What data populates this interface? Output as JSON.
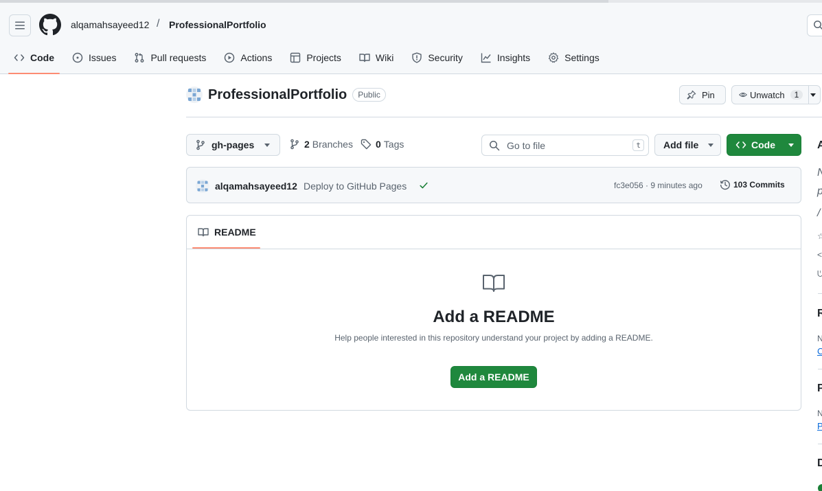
{
  "header": {
    "owner": "alqamahsayeed12",
    "separator": "/",
    "repo": "ProfessionalPortfolio"
  },
  "tabs": [
    {
      "label": "Code",
      "icon": "code-icon",
      "active": true
    },
    {
      "label": "Issues",
      "icon": "issue-icon"
    },
    {
      "label": "Pull requests",
      "icon": "pull-request-icon"
    },
    {
      "label": "Actions",
      "icon": "play-icon"
    },
    {
      "label": "Projects",
      "icon": "table-icon"
    },
    {
      "label": "Wiki",
      "icon": "book-icon"
    },
    {
      "label": "Security",
      "icon": "shield-icon"
    },
    {
      "label": "Insights",
      "icon": "graph-icon"
    },
    {
      "label": "Settings",
      "icon": "gear-icon"
    }
  ],
  "repo": {
    "title": "ProfessionalPortfolio",
    "visibility": "Public",
    "pin_label": "Pin",
    "watch_label": "Unwatch",
    "watch_count": "1"
  },
  "toolbar": {
    "branch": "gh-pages",
    "branches_count": "2",
    "branches_label": "Branches",
    "tags_count": "0",
    "tags_label": "Tags",
    "goto_placeholder": "Go to file",
    "goto_shortcut": "t",
    "add_file_label": "Add file",
    "code_label": "Code"
  },
  "commit": {
    "author": "alqamahsayeed12",
    "message": "Deploy to GitHub Pages",
    "hash_time": "fc3e056 · 9 minutes ago",
    "commits_label": "103 Commits",
    "status_color": "#1a7f37"
  },
  "readme": {
    "tab_label": "README",
    "heading": "Add a README",
    "description": "Help people interested in this repository understand your project by adding a README.",
    "button_label": "Add a README"
  },
  "colors": {
    "accent_green": "#1f883d",
    "tab_underline": "#fd8c73",
    "link_blue": "#0969da"
  }
}
